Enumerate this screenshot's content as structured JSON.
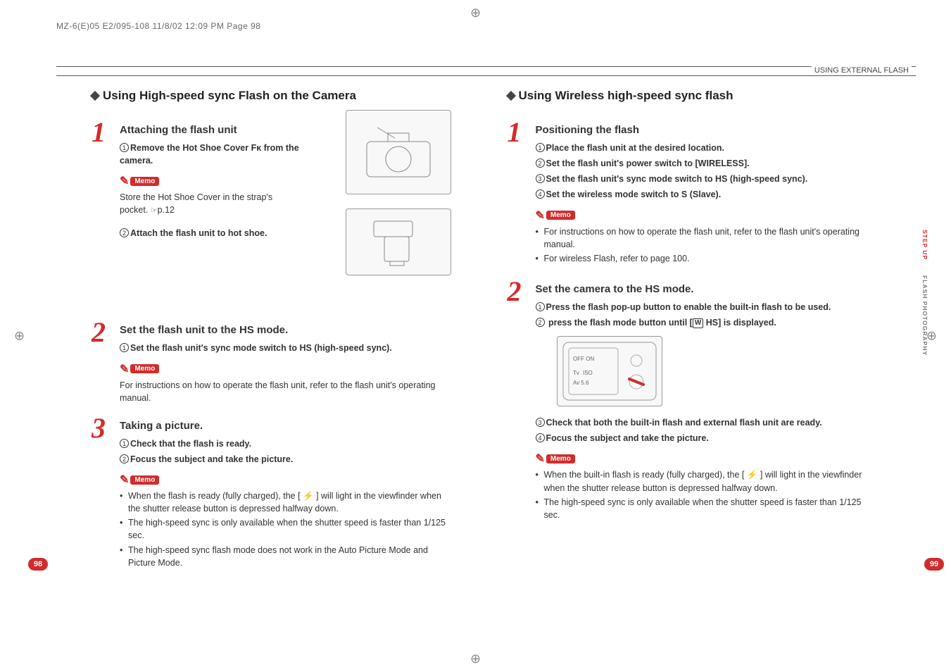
{
  "header_slug": "MZ-6(E)05 E2/095-108  11/8/02  12:09 PM  Page 98",
  "section_header": "USING EXTERNAL FLASH",
  "left": {
    "title": "Using High-speed sync Flash on the Camera",
    "steps": [
      {
        "num": "1",
        "title": "Attaching the flash unit",
        "subs": [
          {
            "n": "1",
            "text": "Remove the Hot Shoe Cover Fκ from the camera."
          }
        ],
        "memo": "Memo",
        "memo_note": "Store the Hot Shoe Cover in the strap's pocket.  ",
        "memo_ref": "p.12",
        "subs2": [
          {
            "n": "2",
            "text": "Attach the flash unit to hot shoe."
          }
        ]
      },
      {
        "num": "2",
        "title": "Set the flash unit to the HS mode.",
        "subs": [
          {
            "n": "1",
            "text": "Set the flash unit's sync mode switch to HS (high-speed sync)."
          }
        ],
        "memo": "Memo",
        "memo_note": "For instructions on how to operate the flash unit, refer to the flash unit's operating manual."
      },
      {
        "num": "3",
        "title": "Taking a picture.",
        "subs": [
          {
            "n": "1",
            "text": "Check that the flash is ready."
          },
          {
            "n": "2",
            "text": "Focus the subject and take the picture."
          }
        ],
        "memo": "Memo",
        "bullets": [
          "When the flash is ready (fully charged), the [ ⚡ ] will light in the viewfinder when the shutter release button is depressed halfway down.",
          "The high-speed sync is only available when the shutter speed is faster than 1/125 sec.",
          "The high-speed sync flash mode does not work in the Auto Picture Mode and Picture Mode."
        ]
      }
    ],
    "page_num": "98"
  },
  "right": {
    "title": "Using Wireless high-speed sync flash",
    "steps": [
      {
        "num": "1",
        "title": "Positioning the flash",
        "subs": [
          {
            "n": "1",
            "text": "Place the flash unit at the desired location."
          },
          {
            "n": "2",
            "text": "Set the flash unit's power switch to [WIRELESS]."
          },
          {
            "n": "3",
            "text": "Set the flash unit's sync mode switch to HS (high-speed sync)."
          },
          {
            "n": "4",
            "text": "Set the wireless mode switch to S (Slave)."
          }
        ],
        "memo": "Memo",
        "bullets": [
          "For instructions on how to operate the flash unit, refer to the flash unit's operating manual.",
          "For wireless Flash, refer to page 100."
        ]
      },
      {
        "num": "2",
        "title": "Set the camera to the HS mode.",
        "subs": [
          {
            "n": "1",
            "text": "Press the flash pop-up button to enable the built-in flash to be used."
          }
        ],
        "sub_hs_prefix": " press the flash mode button until [",
        "sub_hs_w": "W",
        "sub_hs_hs": "HS",
        "sub_hs_suffix": "] is displayed.",
        "sub_hs_n": "2",
        "lcd": {
          "off_on": "OFF  ON",
          "tv": "Tv",
          "iso": "ISO",
          "av": "Av",
          "fnum": "5.6"
        },
        "subs2": [
          {
            "n": "3",
            "text": "Check that both the built-in flash and external flash unit are ready."
          },
          {
            "n": "4",
            "text": "Focus the subject and take the picture."
          }
        ],
        "memo": "Memo",
        "bullets": [
          "When the built-in flash is ready (fully charged), the  [ ⚡ ]  will light in the viewfinder when the shutter release button is depressed halfway down.",
          "The high-speed sync is only available when the shutter speed is faster than 1/125 sec."
        ]
      }
    ],
    "page_num": "99"
  },
  "side_tabs": {
    "step_up": "STEP UP",
    "flash_photo": "FLASH PHOTOGRAPHY"
  },
  "illus": {
    "camera": "(camera illustration)",
    "flash": "(flash unit illustration)",
    "lcd": "(LCD panel illustration)"
  }
}
